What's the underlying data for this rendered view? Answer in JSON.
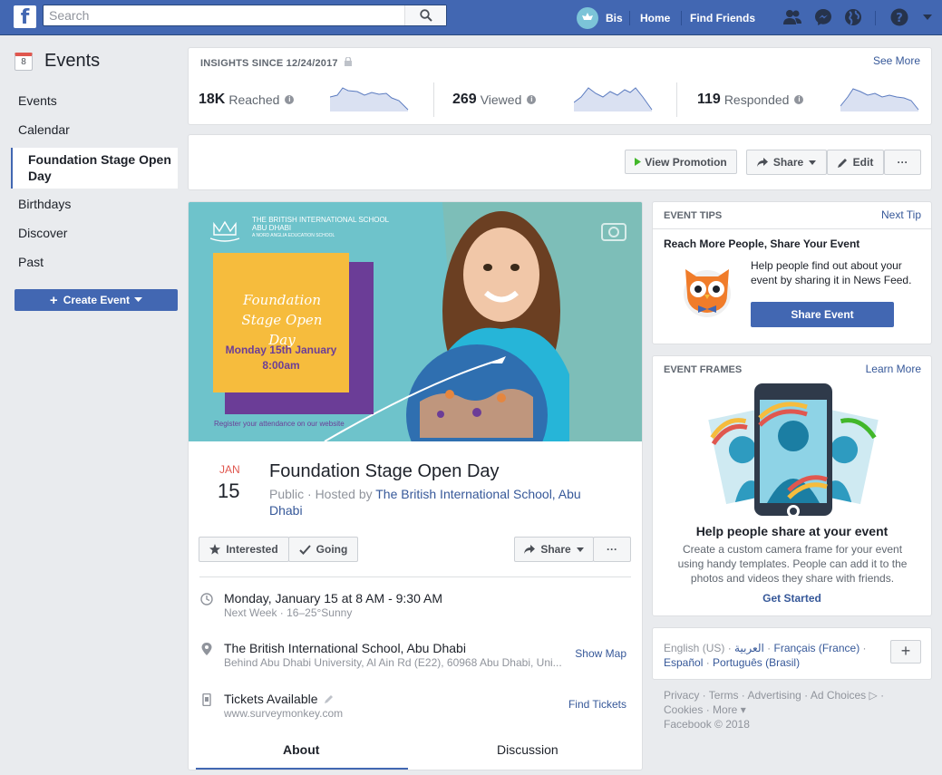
{
  "topbar": {
    "search_placeholder": "Search",
    "user_name": "Bis",
    "home": "Home",
    "find_friends": "Find Friends"
  },
  "sidebar": {
    "title": "Events",
    "calendar_icon_day": "8",
    "items": [
      "Events",
      "Calendar",
      "Foundation Stage Open Day",
      "Birthdays",
      "Discover",
      "Past"
    ],
    "create_button": "Create Event"
  },
  "insights": {
    "title": "INSIGHTS SINCE 12/24/2017",
    "see_more": "See More",
    "metrics": [
      {
        "value": "18K",
        "label": "Reached"
      },
      {
        "value": "269",
        "label": "Viewed"
      },
      {
        "value": "119",
        "label": "Responded"
      }
    ]
  },
  "actions": {
    "view_promotion": "View Promotion",
    "share": "Share",
    "edit": "Edit",
    "more": "···"
  },
  "cover": {
    "school_line1": "THE BRITISH INTERNATIONAL SCHOOL",
    "school_line2": "ABU DHABI",
    "school_line3": "A NORD ANGLIA EDUCATION SCHOOL",
    "poster_title": "Foundation Stage Open Day",
    "poster_date": "Monday 15th January",
    "poster_time": "8:00am",
    "register_text": "Register your attendance on our website"
  },
  "event": {
    "month": "JAN",
    "day": "15",
    "title": "Foundation Stage Open Day",
    "privacy": "Public · Hosted by ",
    "host": "The British International School, Abu Dhabi",
    "interested": "Interested",
    "going": "Going",
    "share": "Share",
    "more": "···",
    "when": "Monday, January 15 at 8 AM - 9:30 AM",
    "when_sub": "Next Week · 16–25°Sunny",
    "where": "The British International School, Abu Dhabi",
    "where_sub": "Behind Abu Dhabi University, Al Ain Rd (E22), 60968 Abu Dhabi, Uni...",
    "show_map": "Show Map",
    "tickets": "Tickets Available",
    "tickets_sub": "www.surveymonkey.com",
    "find_tickets": "Find Tickets",
    "tab_about": "About",
    "tab_discussion": "Discussion"
  },
  "tips": {
    "header": "EVENT TIPS",
    "next": "Next Tip",
    "heading": "Reach More People, Share Your Event",
    "text": "Help people find out about your event by sharing it in News Feed.",
    "button": "Share Event"
  },
  "frames": {
    "header": "EVENT FRAMES",
    "learn_more": "Learn More",
    "heading": "Help people share at your event",
    "text": "Create a custom camera frame for your event using handy templates. People can add it to the photos and videos they share with friends.",
    "link": "Get Started"
  },
  "languages": {
    "current": "English (US) · ",
    "arabic": "العربية",
    "sep1": " · ",
    "french": "Français (France)",
    "sep2": " · ",
    "spanish": "Español",
    "sep3": " · ",
    "portuguese": "Português (Brasil)"
  },
  "footer": {
    "line1": "Privacy · Terms · Advertising · Ad Choices ▷ ·",
    "line2": "Cookies · More ▾",
    "line3": "Facebook © 2018"
  },
  "colors": {
    "brand": "#4267b2",
    "background": "#e9ebee",
    "link": "#365899",
    "date_red": "#e0574f",
    "poster_yellow": "#f6bc3d",
    "poster_purple": "#6b3d97"
  }
}
